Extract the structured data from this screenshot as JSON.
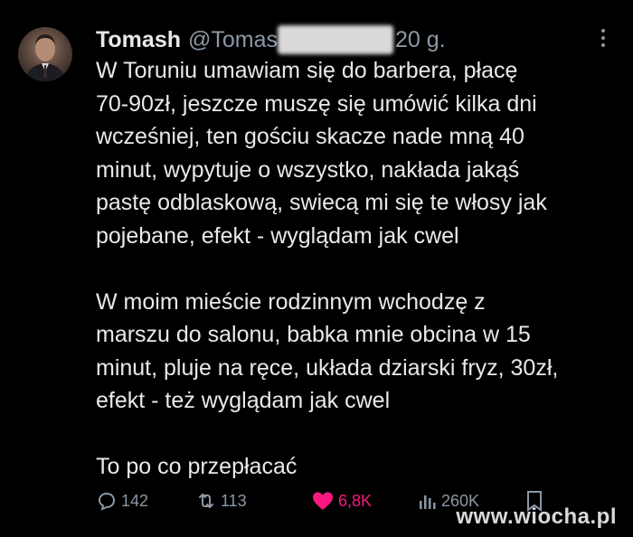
{
  "tweet": {
    "author_name": "Tomash",
    "author_handle": "@Tomas",
    "time": "20 g.",
    "lines_p1": [
      "W Toruniu umawiam się do barbera, płacę",
      "70-90zł, jeszcze muszę się umówić kilka dni",
      "wcześniej, ten gościu skacze nade mną 40",
      "minut, wypytuje o wszystko, nakłada jakąś",
      "pastę odblaskową, swiecą mi się te włosy jak",
      "pojebane, efekt - wyglądam jak cwel"
    ],
    "lines_p2": [
      "W moim mieście rodzinnym wchodzę z",
      "marszu do salonu, babka mnie obcina w 15",
      "minut, pluje na ręce, układa dziarski fryz, 30zł,",
      "efekt - też wyglądam jak cwel"
    ],
    "lines_p3": [
      "To po co przepłacać"
    ]
  },
  "actions": {
    "replies": "142",
    "reposts": "113",
    "likes": "6,8K",
    "views": "260K"
  },
  "watermark": "www.wiocha.pl",
  "colors": {
    "background": "#000000",
    "text": "#e7e9ea",
    "muted": "#8b98a5",
    "like": "#f91880"
  }
}
